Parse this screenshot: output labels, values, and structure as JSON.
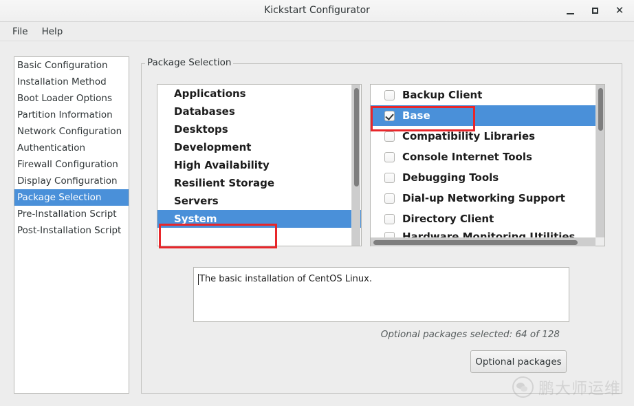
{
  "window": {
    "title": "Kickstart Configurator",
    "controls": [
      {
        "name": "minimize",
        "glyph": "_"
      },
      {
        "name": "maximize",
        "glyph": "□"
      },
      {
        "name": "close",
        "glyph": "×"
      }
    ]
  },
  "menubar": {
    "items": [
      "File",
      "Help"
    ]
  },
  "sidebar": {
    "items": [
      {
        "label": "Basic Configuration",
        "selected": false
      },
      {
        "label": "Installation Method",
        "selected": false
      },
      {
        "label": "Boot Loader Options",
        "selected": false
      },
      {
        "label": "Partition Information",
        "selected": false
      },
      {
        "label": "Network Configuration",
        "selected": false
      },
      {
        "label": "Authentication",
        "selected": false
      },
      {
        "label": "Firewall Configuration",
        "selected": false
      },
      {
        "label": "Display Configuration",
        "selected": false
      },
      {
        "label": "Package Selection",
        "selected": true
      },
      {
        "label": "Pre-Installation Script",
        "selected": false
      },
      {
        "label": "Post-Installation Script",
        "selected": false
      }
    ]
  },
  "frame": {
    "legend": "Package Selection"
  },
  "group_list": {
    "items": [
      {
        "label": "Applications",
        "selected": false
      },
      {
        "label": "Databases",
        "selected": false
      },
      {
        "label": "Desktops",
        "selected": false
      },
      {
        "label": "Development",
        "selected": false
      },
      {
        "label": "High Availability",
        "selected": false
      },
      {
        "label": "Resilient Storage",
        "selected": false
      },
      {
        "label": "Servers",
        "selected": false
      },
      {
        "label": "System",
        "selected": true
      }
    ],
    "scrollbar": {
      "orientation": "vertical",
      "thumb_top_pct": 2,
      "thumb_height_pct": 61
    }
  },
  "package_list": {
    "items": [
      {
        "label": "Backup Client",
        "checked": false,
        "selected": false,
        "clipped": false
      },
      {
        "label": "Base",
        "checked": true,
        "selected": true,
        "clipped": false
      },
      {
        "label": "Compatibility Libraries",
        "checked": false,
        "selected": false,
        "clipped": false
      },
      {
        "label": "Console Internet Tools",
        "checked": false,
        "selected": false,
        "clipped": false
      },
      {
        "label": "Debugging Tools",
        "checked": false,
        "selected": false,
        "clipped": false
      },
      {
        "label": "Dial-up Networking Support",
        "checked": false,
        "selected": false,
        "clipped": false
      },
      {
        "label": "Directory Client",
        "checked": false,
        "selected": false,
        "clipped": false
      },
      {
        "label": "Hardware Monitoring Utilities",
        "checked": false,
        "selected": false,
        "clipped": true
      }
    ],
    "vscrollbar": {
      "thumb_top_pct": 2,
      "thumb_height_pct": 28
    },
    "hscrollbar": {
      "thumb_left_pct": 1,
      "thumb_width_pct": 91
    }
  },
  "description": {
    "text": "The basic installation of CentOS Linux."
  },
  "status": {
    "text": "Optional packages selected: 64 of 128"
  },
  "buttons": {
    "optional_packages": "Optional packages"
  },
  "watermark": {
    "text": "鹏大师运维",
    "icon": "wechat-logo"
  },
  "colors": {
    "selection_blue": "#4a90d9",
    "annotation_red": "#e8262a",
    "window_bg": "#ededed",
    "list_bg": "#ffffff"
  }
}
